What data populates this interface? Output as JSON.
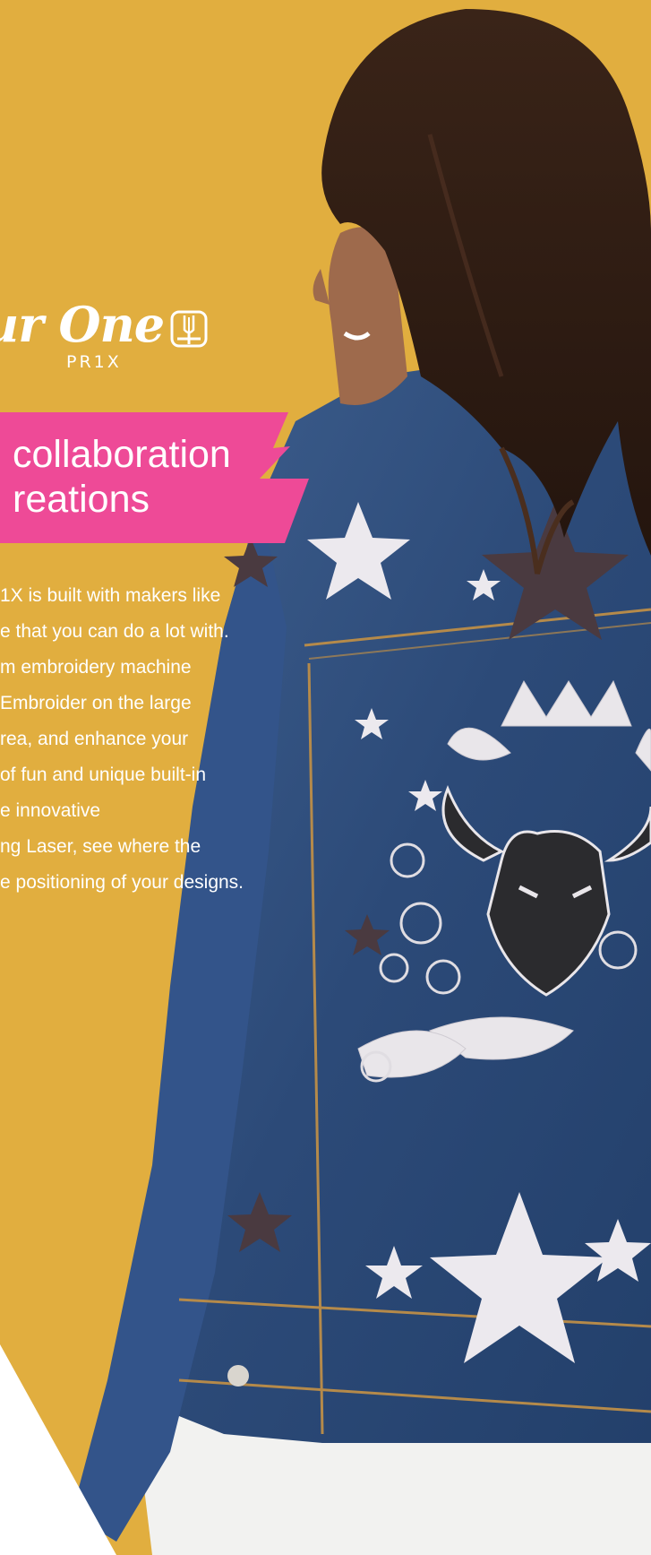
{
  "logo": {
    "script": "ur One",
    "model": "PR1X",
    "icon": "needle-hoop-icon"
  },
  "banner": {
    "line1": " collaboration",
    "line2": "reations",
    "color": "#EE4A97"
  },
  "body": {
    "lines": [
      "1X is built with makers like",
      "e that you can do a lot with.",
      "m embroidery machine",
      "Embroider on the large",
      "rea, and enhance your",
      " of fun and unique built-in",
      "e innovative",
      "ng Laser, see where the",
      "e positioning of your designs."
    ]
  },
  "colors": {
    "background": "#E1AE3F",
    "accent": "#EE4A97",
    "denim": "#2F4F7F"
  }
}
